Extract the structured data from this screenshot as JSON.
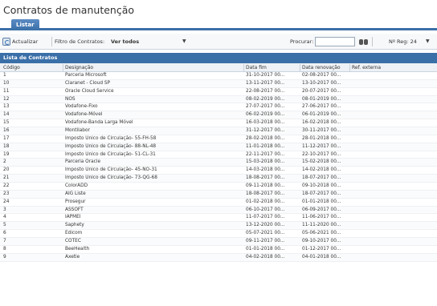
{
  "page": {
    "title": "Contratos de manutenção"
  },
  "tabs": [
    {
      "label": "Listar"
    }
  ],
  "toolbar": {
    "refresh_label": "Actualizar",
    "filter_label": "Filtro de Contratos:",
    "filter_value": "Ver todos",
    "search_label": "Procurar:",
    "search_value": "",
    "page_size_label": "Nº Reg: 24"
  },
  "grid": {
    "title": "Lista de Contratos",
    "columns": [
      "Código",
      "Designação",
      "Data fim",
      "Data renovação",
      "Ref. externa"
    ],
    "rows": [
      [
        "1",
        "Parceria Microsoft",
        "31-10-2017 00...",
        "02-08-2017 00...",
        ""
      ],
      [
        "10",
        "Claranet - Cloud SP",
        "13-11-2017 00...",
        "13-10-2017 00...",
        ""
      ],
      [
        "11",
        "Oracle Cloud Service",
        "22-08-2017 00...",
        "20-07-2017 00...",
        ""
      ],
      [
        "12",
        "NOS",
        "08-02-2019 00...",
        "08-01-2019 00...",
        ""
      ],
      [
        "13",
        "Vodafone-Fixo",
        "27-07-2017 00...",
        "27-06-2017 00...",
        ""
      ],
      [
        "14",
        "Vodafone-Móvel",
        "06-02-2019 00...",
        "06-01-2019 00...",
        ""
      ],
      [
        "15",
        "Vodafone-Banda Larga Móvel",
        "16-03-2018 00...",
        "16-02-2018 00...",
        ""
      ],
      [
        "16",
        "Montilabor",
        "31-12-2017 00...",
        "30-11-2017 00...",
        ""
      ],
      [
        "17",
        "Imposto Único de Circulação- 55-FH-58",
        "28-02-2018 00...",
        "28-01-2018 00...",
        ""
      ],
      [
        "18",
        "Imposto Único de Circulação- 88-NL-48",
        "11-01-2018 00...",
        "11-12-2017 00...",
        ""
      ],
      [
        "19",
        "Imposto Único de Circulação- 51-CL-31",
        "22-11-2017 00...",
        "22-10-2017 00...",
        ""
      ],
      [
        "2",
        "Parceria Oracle",
        "15-03-2018 00...",
        "15-02-2018 00...",
        ""
      ],
      [
        "20",
        "Imposto Único de Circulação- 45-NO-31",
        "14-03-2018 00...",
        "14-02-2018 00...",
        ""
      ],
      [
        "21",
        "Imposto Único de Circulação- 73-QG-68",
        "18-08-2017 00...",
        "18-07-2017 00...",
        ""
      ],
      [
        "22",
        "ColorADD",
        "09-11-2018 00...",
        "09-10-2018 00...",
        ""
      ],
      [
        "23",
        "AIG Liste",
        "18-08-2017 00...",
        "18-07-2017 00...",
        ""
      ],
      [
        "24",
        "Prosegur",
        "01-02-2018 00...",
        "01-01-2018 00...",
        ""
      ],
      [
        "3",
        "ASSOFT",
        "06-10-2017 00...",
        "06-09-2017 00...",
        ""
      ],
      [
        "4",
        "IAPMEI",
        "11-07-2017 00...",
        "11-06-2017 00...",
        ""
      ],
      [
        "5",
        "Saphety",
        "13-12-2020 00...",
        "11-11-2020 00...",
        ""
      ],
      [
        "6",
        "Edicom",
        "05-07-2021 00...",
        "05-06-2021 00...",
        ""
      ],
      [
        "7",
        "COTEC",
        "09-11-2017 00...",
        "09-10-2017 00...",
        ""
      ],
      [
        "8",
        "BeeHealth",
        "01-01-2018 00...",
        "01-12-2017 00...",
        ""
      ],
      [
        "9",
        "Axetie",
        "04-02-2018 00...",
        "04-01-2018 00...",
        ""
      ]
    ]
  }
}
